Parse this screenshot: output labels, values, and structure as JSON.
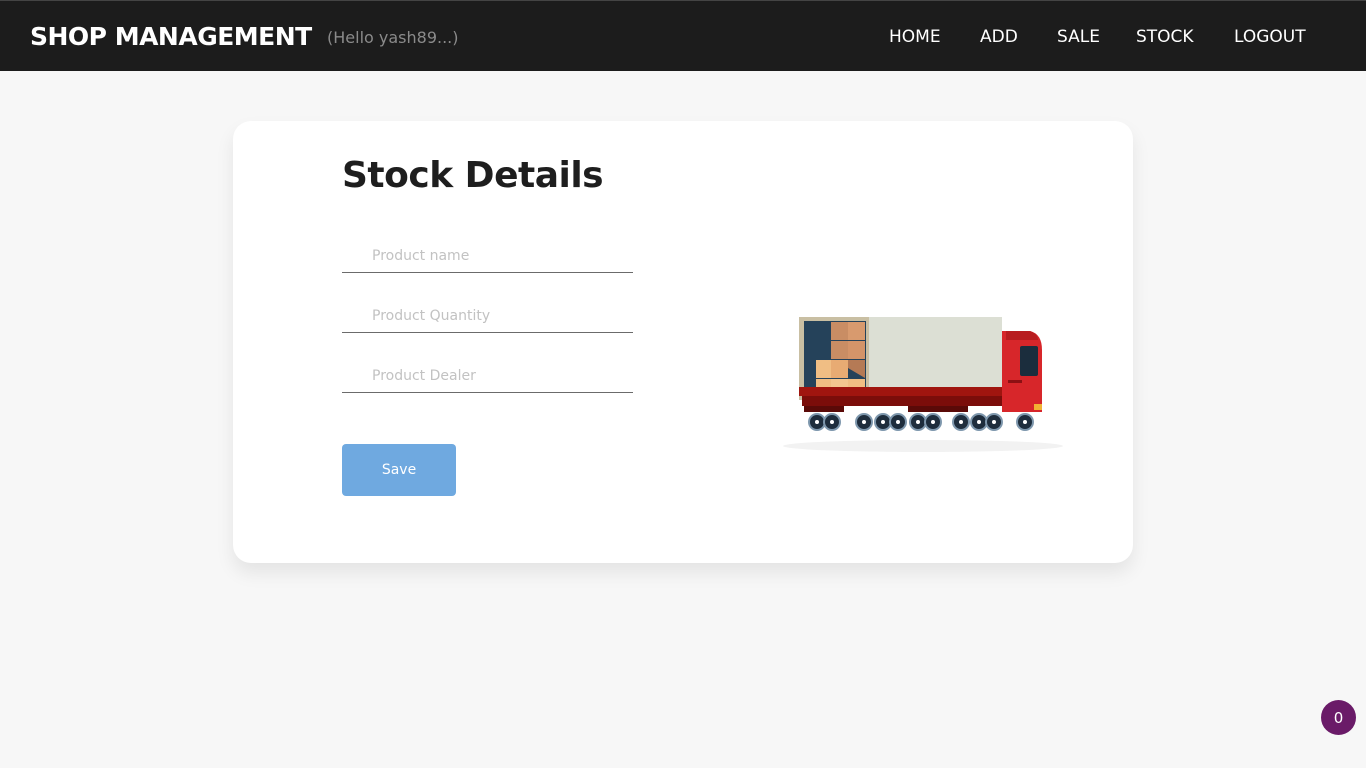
{
  "navbar": {
    "brand": "SHOP MANAGEMENT",
    "greeting": "(Hello yash89...)",
    "links": [
      {
        "label": "HOME"
      },
      {
        "label": "ADD"
      },
      {
        "label": "SALE"
      },
      {
        "label": "STOCK"
      },
      {
        "label": "LOGOUT"
      }
    ]
  },
  "form": {
    "title": "Stock Details",
    "fields": [
      {
        "placeholder": "Product name",
        "value": ""
      },
      {
        "placeholder": "Product Quantity",
        "value": ""
      },
      {
        "placeholder": "Product Dealer",
        "value": ""
      }
    ],
    "save_label": "Save",
    "illustration_icon": "delivery-truck-icon"
  },
  "badge": {
    "count": "0"
  },
  "colors": {
    "navbar_bg": "#1c1c1c",
    "page_bg": "#f7f7f7",
    "button": "#6fa9e0",
    "badge": "#6a1b68"
  }
}
